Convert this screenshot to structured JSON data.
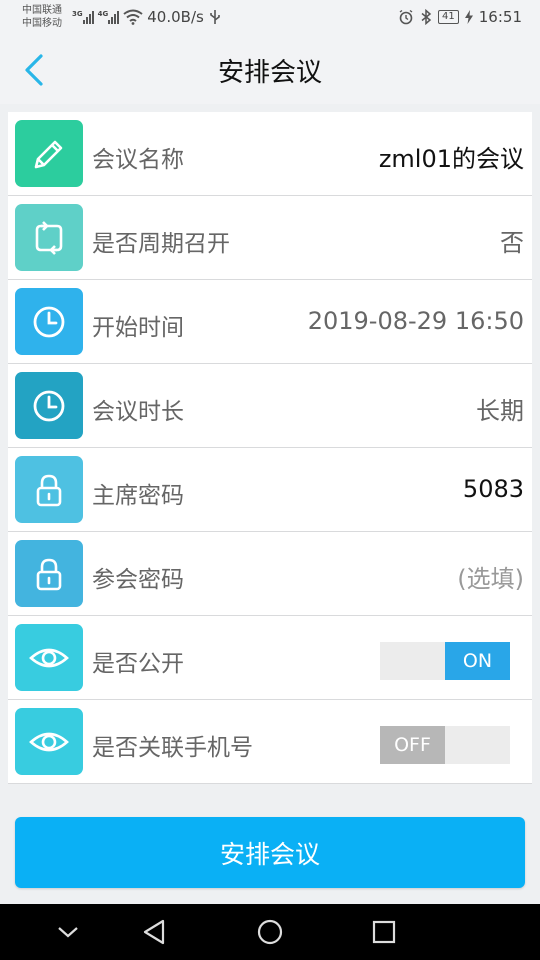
{
  "status_bar": {
    "carrier_1": "中国联通",
    "carrier_2": "中国移动",
    "net_1": "3G",
    "net_2": "4G",
    "speed": "40.0B/s",
    "battery": "41",
    "time": "16:51"
  },
  "header": {
    "title": "安排会议",
    "back_icon": "chevron-left-icon"
  },
  "form": {
    "rows": [
      {
        "label": "会议名称",
        "value": "zml01的会议",
        "icon": "pencil-icon",
        "color": "#2ccd9e"
      },
      {
        "label": "是否周期召开",
        "value": "否",
        "icon": "repeat-icon",
        "color": "#5fd0c8"
      },
      {
        "label": "开始时间",
        "value": "2019-08-29 16:50",
        "icon": "clock-icon",
        "color": "#2fb2ec"
      },
      {
        "label": "会议时长",
        "value": "长期",
        "icon": "clock-icon",
        "color": "#23a3c3"
      },
      {
        "label": "主席密码",
        "value": "5083",
        "icon": "lock-icon",
        "color": "#4ec1e2"
      },
      {
        "label": "参会密码",
        "placeholder": "(选填)",
        "icon": "lock-icon",
        "color": "#43b4df"
      },
      {
        "label": "是否公开",
        "toggle": "ON",
        "icon": "eye-icon",
        "color": "#38cce0"
      },
      {
        "label": "是否关联手机号",
        "toggle": "OFF",
        "icon": "eye-icon",
        "color": "#38cce0"
      }
    ]
  },
  "submit_label": "安排会议",
  "colors": {
    "accent": "#0ab0f5",
    "toggle_on": "#29a6e8",
    "toggle_off": "#b7b7b7"
  }
}
